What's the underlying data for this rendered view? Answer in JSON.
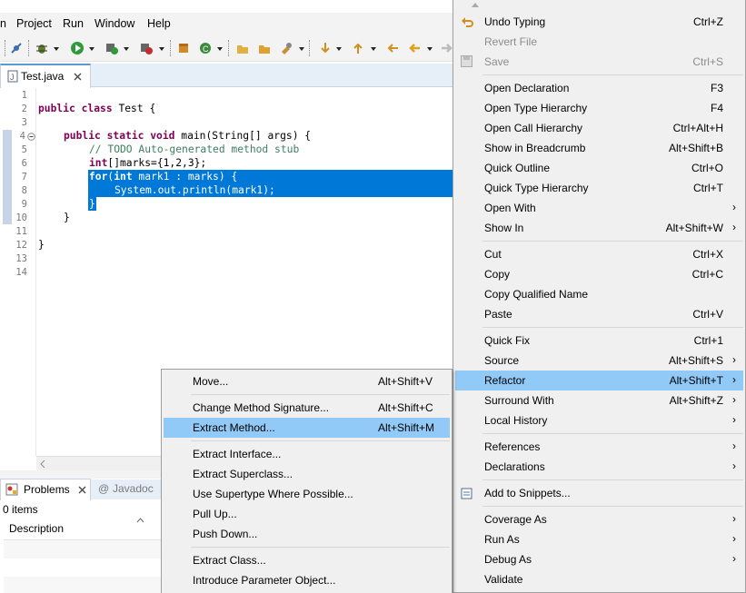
{
  "menubar": {
    "items": [
      "n",
      "Project",
      "Run",
      "Window",
      "Help"
    ]
  },
  "editor": {
    "tab_title": "Test.java",
    "line_numbers": [
      "1",
      "2",
      "3",
      "4",
      "5",
      "6",
      "7",
      "8",
      "9",
      "10",
      "11",
      "12",
      "13",
      "14"
    ],
    "lines": {
      "l2_kw1": "public",
      "l2_kw2": "class",
      "l2_rest": " Test {",
      "l4_kw1": "public",
      "l4_kw2": "static",
      "l4_kw3": "void",
      "l4_rest": " main(String[] args) {",
      "l5": "// TODO Auto-generated method stub",
      "l6_kw": "int",
      "l6_rest": "[]marks={1,2,3};",
      "l7_kw1": "for",
      "l7_a": "(",
      "l7_kw2": "int",
      "l7_rest": " mark1 : marks) {",
      "l8": "System.out.println(mark1);",
      "l9": "}",
      "l10": "}",
      "l12": "}"
    }
  },
  "bottom": {
    "problems_tab": "Problems",
    "javadoc_tab": "Javadoc",
    "count": "0 items",
    "col_description": "Description"
  },
  "context_menu": {
    "items": [
      {
        "label": "Undo Typing",
        "accel": "Ctrl+Z"
      },
      {
        "label": "Revert File",
        "accel": ""
      },
      {
        "label": "Save",
        "accel": "Ctrl+S"
      },
      {
        "label": "Open Declaration",
        "accel": "F3"
      },
      {
        "label": "Open Type Hierarchy",
        "accel": "F4"
      },
      {
        "label": "Open Call Hierarchy",
        "accel": "Ctrl+Alt+H"
      },
      {
        "label": "Show in Breadcrumb",
        "accel": "Alt+Shift+B"
      },
      {
        "label": "Quick Outline",
        "accel": "Ctrl+O"
      },
      {
        "label": "Quick Type Hierarchy",
        "accel": "Ctrl+T"
      },
      {
        "label": "Open With",
        "accel": ""
      },
      {
        "label": "Show In",
        "accel": "Alt+Shift+W"
      },
      {
        "label": "Cut",
        "accel": "Ctrl+X"
      },
      {
        "label": "Copy",
        "accel": "Ctrl+C"
      },
      {
        "label": "Copy Qualified Name",
        "accel": ""
      },
      {
        "label": "Paste",
        "accel": "Ctrl+V"
      },
      {
        "label": "Quick Fix",
        "accel": "Ctrl+1"
      },
      {
        "label": "Source",
        "accel": "Alt+Shift+S"
      },
      {
        "label": "Refactor",
        "accel": "Alt+Shift+T"
      },
      {
        "label": "Surround With",
        "accel": "Alt+Shift+Z"
      },
      {
        "label": "Local History",
        "accel": ""
      },
      {
        "label": "References",
        "accel": ""
      },
      {
        "label": "Declarations",
        "accel": ""
      },
      {
        "label": "Add to Snippets...",
        "accel": ""
      },
      {
        "label": "Coverage As",
        "accel": ""
      },
      {
        "label": "Run As",
        "accel": ""
      },
      {
        "label": "Debug As",
        "accel": ""
      },
      {
        "label": "Validate",
        "accel": ""
      }
    ],
    "submenu_arrow": "›"
  },
  "refactor_submenu": {
    "items": [
      {
        "label": "Move...",
        "accel": "Alt+Shift+V"
      },
      {
        "label": "Change Method Signature...",
        "accel": "Alt+Shift+C"
      },
      {
        "label": "Extract Method...",
        "accel": "Alt+Shift+M"
      },
      {
        "label": "Extract Interface...",
        "accel": ""
      },
      {
        "label": "Extract Superclass...",
        "accel": ""
      },
      {
        "label": "Use Supertype Where Possible...",
        "accel": ""
      },
      {
        "label": "Pull Up...",
        "accel": ""
      },
      {
        "label": "Push Down...",
        "accel": ""
      },
      {
        "label": "Extract Class...",
        "accel": ""
      },
      {
        "label": "Introduce Parameter Object...",
        "accel": ""
      }
    ]
  },
  "colors": {
    "highlight": "#91c9f7",
    "selection": "#0078d7",
    "keyword": "#7f0055",
    "comment": "#3f7f5f"
  }
}
